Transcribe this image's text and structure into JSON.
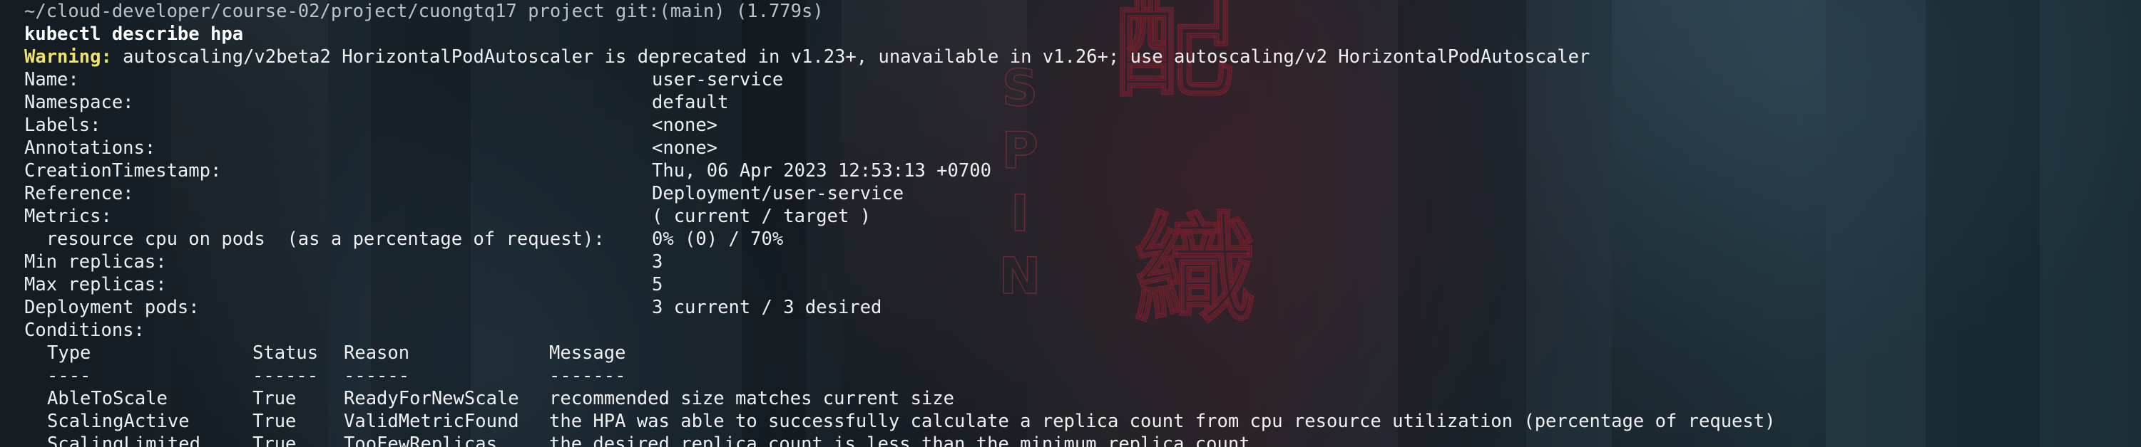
{
  "window": {
    "prompt": "~/cloud-developer/course-02/project/cuongtq17 project git:(main) (1.779s)",
    "command": "kubectl describe hpa"
  },
  "warning": {
    "label": "Warning:",
    "text": " autoscaling/v2beta2 HorizontalPodAutoscaler is deprecated in v1.23+, unavailable in v1.26+; use autoscaling/v2 HorizontalPodAutoscaler"
  },
  "fields": [
    {
      "key": "Name:",
      "value": "user-service"
    },
    {
      "key": "Namespace:",
      "value": "default"
    },
    {
      "key": "Labels:",
      "value": "<none>"
    },
    {
      "key": "Annotations:",
      "value": "<none>"
    },
    {
      "key": "CreationTimestamp:",
      "value": "Thu, 06 Apr 2023 12:53:13 +0700"
    },
    {
      "key": "Reference:",
      "value": "Deployment/user-service"
    },
    {
      "key": "Metrics:",
      "value": "( current / target )"
    },
    {
      "key": "  resource cpu on pods  (as a percentage of request):",
      "value": "0% (0) / 70%"
    },
    {
      "key": "Min replicas:",
      "value": "3"
    },
    {
      "key": "Max replicas:",
      "value": "5"
    },
    {
      "key": "Deployment pods:",
      "value": "3 current / 3 desired"
    }
  ],
  "conditions": {
    "title": "Conditions:",
    "headers": {
      "type": "Type",
      "status": "Status",
      "reason": "Reason",
      "message": "Message"
    },
    "separators": {
      "type": "----",
      "status": "------",
      "reason": "------",
      "message": "-------"
    },
    "rows": [
      {
        "type": "AbleToScale",
        "status": "True",
        "reason": "ReadyForNewScale",
        "message": "recommended size matches current size"
      },
      {
        "type": "ScalingActive",
        "status": "True",
        "reason": "ValidMetricFound",
        "message": "the HPA was able to successfully calculate a replica count from cpu resource utilization (percentage of request)"
      },
      {
        "type": "ScalingLimited",
        "status": "True",
        "reason": "TooFewReplicas",
        "message": "the desired replica count is less than the minimum replica count"
      }
    ]
  },
  "colors": {
    "warning": "#f0e36a",
    "text": "#eef0f1",
    "background": "#152027"
  }
}
